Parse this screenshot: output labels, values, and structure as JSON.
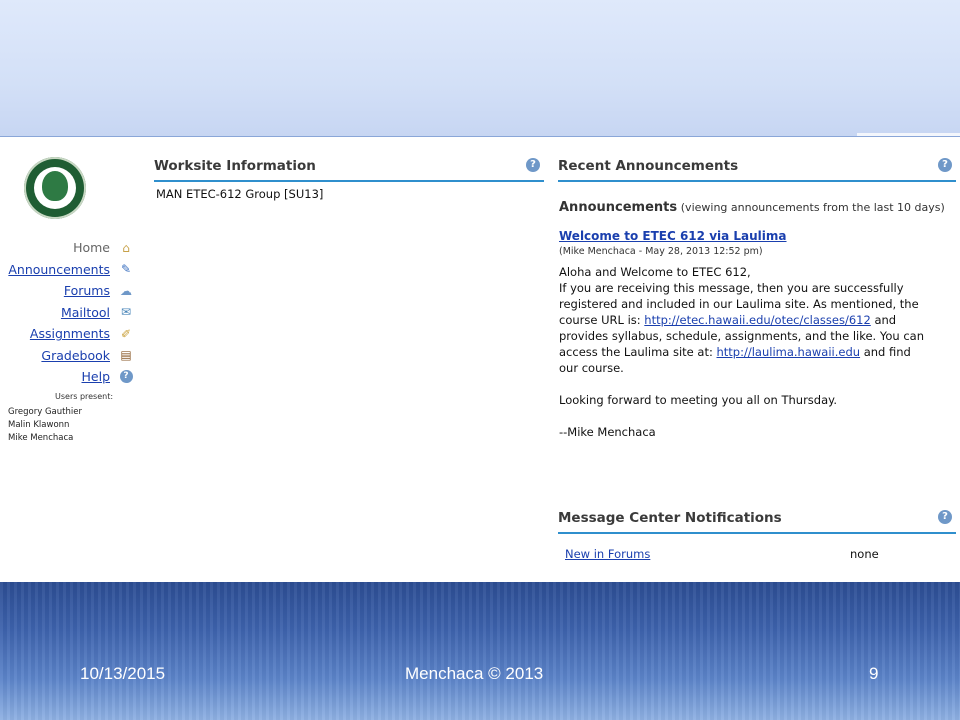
{
  "nav": {
    "items": [
      {
        "label": "Home",
        "icon": "home-icon"
      },
      {
        "label": "Announcements",
        "icon": "announcements-icon"
      },
      {
        "label": "Forums",
        "icon": "forums-icon"
      },
      {
        "label": "Mailtool",
        "icon": "mail-icon"
      },
      {
        "label": "Assignments",
        "icon": "assignments-icon"
      },
      {
        "label": "Gradebook",
        "icon": "gradebook-icon"
      },
      {
        "label": "Help",
        "icon": "help-icon"
      }
    ],
    "users_label": "Users present:",
    "users": [
      "Gregory Gauthier",
      "Malin Klawonn",
      "Mike Menchaca"
    ]
  },
  "worksite": {
    "title": "Worksite Information",
    "group": "MAN ETEC-612 Group [SU13]"
  },
  "recent": {
    "title": "Recent Announcements",
    "heading": "Announcements",
    "subheading": "(viewing announcements from the last 10 days)",
    "post_title": "Welcome to ETEC 612 via Laulima",
    "post_meta": "(Mike Menchaca - May 28, 2013 12:52 pm)",
    "line1": "Aloha and Welcome to ETEC 612,",
    "line2": "If you are receiving this message, then you are successfully",
    "line3": "registered and included in our Laulima site. As mentioned, the",
    "line4a": "course URL is: ",
    "url1": "http://etec.hawaii.edu/otec/classes/612",
    "line4b": " and",
    "line5": "provides syllabus, schedule, assignments, and the like. You can",
    "line6a": "access the Laulima site at: ",
    "url2": "http://laulima.hawaii.edu",
    "line6b": " and find",
    "line7": "our course.",
    "line8": "Looking forward to meeting you all on Thursday.",
    "signoff": "--Mike Menchaca"
  },
  "message_center": {
    "title": "Message Center Notifications",
    "link": "New in Forums",
    "value": "none"
  },
  "footer": {
    "date": "10/13/2015",
    "author": "Menchaca © 2013",
    "page": "9"
  },
  "colors": {
    "accent": "#2f8fcd",
    "link": "#1a3fae",
    "logo": "#1f5d33"
  }
}
